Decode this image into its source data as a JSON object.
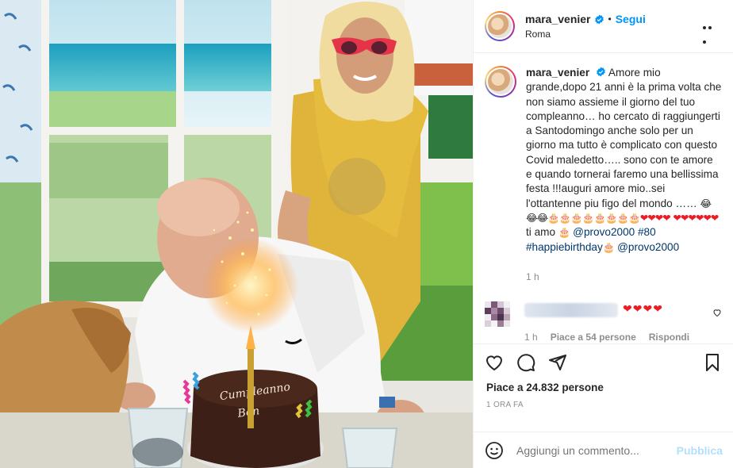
{
  "header": {
    "username": "mara_venier",
    "separator": "•",
    "follow_label": "Segui",
    "location": "Roma"
  },
  "caption": {
    "username": "mara_venier",
    "text": "Amore mio grande,dopo 21 anni è la prima volta che non siamo assieme il giorno del tuo compleanno… ho cercato di raggiungerti a Santodomingo anche solo per un giorno ma tutto è complicato con questo Covid maledetto….. sono con te amore e quando tornerai faremo una bellissima festa !!!auguri amore mio..sei l'ottantenne piu figo del mondo ……",
    "emoji_line_1_faces": "😂😂",
    "emoji_line_1_cakes": "🎂🎂🎂🎂🎂🎂🎂🎂",
    "emoji_line_1_hearts": "❤❤❤❤",
    "emoji_line_2_hearts": "❤❤❤❤❤❤",
    "ti_amo": "ti amo",
    "mention_1": "@provo2000",
    "hashtags": "#80 #happiebirthday",
    "mention_2": "@provo2000",
    "face_end": "😂",
    "cake_single": "🎂",
    "time": "1 h"
  },
  "comment": {
    "hearts": "❤❤❤❤",
    "time": "1 h",
    "likes": "Piace a 54 persone",
    "reply": "Rispondi"
  },
  "post": {
    "likes": "Piace a 24.832 persone",
    "ago": "1 ORA FA"
  },
  "add_comment": {
    "placeholder": "Aggiungi un commento...",
    "publish": "Pubblica"
  },
  "photo": {
    "cake_writing_1": "Cumpleanno",
    "cake_writing_2": "Bon"
  },
  "colors": {
    "link_blue": "#0095f6",
    "mention_blue": "#00376b",
    "heart_red": "#ed1c24",
    "muted": "#8e8e8e"
  }
}
